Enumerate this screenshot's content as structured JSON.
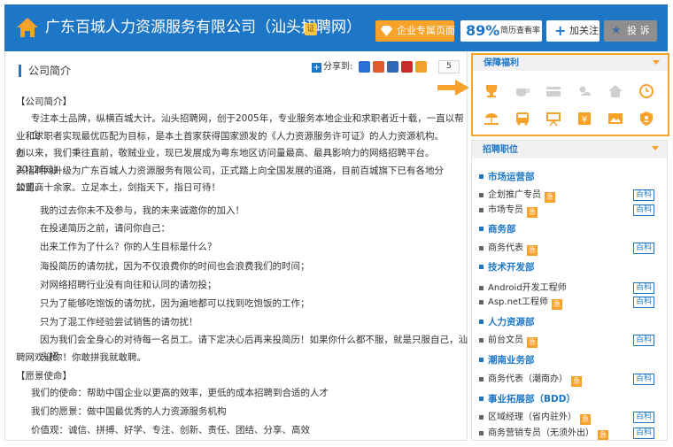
{
  "header": {
    "company_name": "广东百城人力资源服务有限公司（汕头招聘网）",
    "cert_label": "证",
    "enterprise_page_label": "企业专属页面",
    "resume_rate_value": "89%",
    "resume_rate_label": "简历查看率",
    "follow_label": "加关注",
    "report_label": "投 诉"
  },
  "intro": {
    "title": "公司简介",
    "share_label": "分享到:",
    "share_count": "5",
    "share_sites": [
      {
        "name": "qzone",
        "color": "#2a6fd6"
      },
      {
        "name": "sina-weibo",
        "color": "#e25b2a"
      },
      {
        "name": "renren",
        "color": "#2d69b7"
      },
      {
        "name": "kaixin",
        "color": "#c72b2a"
      },
      {
        "name": "tencent-weibo",
        "color": "#f1a22e"
      },
      {
        "name": "douban",
        "color": "#3f9e3f"
      },
      {
        "name": "baidu",
        "color": "#2c62c7"
      }
    ],
    "paragraphs": [
      "【公司简介】",
      "专注本土品牌，纵横百城大计。汕头招聘网，创于2005年，专业服务本地企业和求职者近十载，一直以帮企",
      "业和求职者实现最优匹配为目标，是本土首家获得国家颁发的《人力资源服务许可证》的人力资源机构。创",
      "办以来，我们秉往直前，敬贼业业，现已发展成为粤东地区访问量最高、最具影响力的网络招聘平台。2012年汕",
      "头招聘网升级为广东百城人力资源服务有限公司，正式踏上向全国发展的道路，目前百城旗下已有各地分公司、",
      "加盟商十余家。立足本土，剑指天下，指日可待！",
      "我的过去你未不及参与，我的未来诚邀你的加入！",
      "在投递简历之前，请问你自己：",
      "出来工作为了什么？你的人生目标是什么？",
      "海投简历的请勿扰，因为不仅浪费你的时间也会浪费我们的时间；",
      "对网络招聘行业没有向往和认同的请勿投；",
      "只为了能够吃饱饭的请勿扰，因为遍地都可以找到吃饱饭的工作；",
      "只为了混工作经验尝试销售的请勿扰！",
      "因为我们会全身心的对待每一名员工。请下定决心后再来投简历！如果你什么都不服，就是只服自己，汕头招",
      "聘网欢迎你！你敢拼我就敢聘。",
      "【愿景使命】",
      "我们的使命：帮助中国企业以更高的效率，更低的成本招聘到合适的人才",
      "我们的愿景：做中国最优秀的人力资源服务机构",
      "价值观：诚信、拼搏、好学、专注、创新、责任、团结、分享、高效"
    ]
  },
  "benefits": {
    "title": "保障福利",
    "icons": [
      {
        "name": "bonus-cup",
        "color": "#f7a22b"
      },
      {
        "name": "coffee",
        "color": "#cfcfcf"
      },
      {
        "name": "card",
        "color": "#cfcfcf"
      },
      {
        "name": "sun-weather",
        "color": "#cfcfcf"
      },
      {
        "name": "housing",
        "color": "#cfcfcf"
      },
      {
        "name": "clock",
        "color": "#f7a22b"
      },
      {
        "name": "beach-travel",
        "color": "#f7a22b"
      },
      {
        "name": "shuttle-bus",
        "color": "#f7a22b"
      },
      {
        "name": "training-board",
        "color": "#f7a22b"
      },
      {
        "name": "yuan-allowance",
        "color": "#f7a22b"
      },
      {
        "name": "photo-activities",
        "color": "#f7a22b"
      },
      {
        "name": "insurance-shield",
        "color": "#f7a22b"
      }
    ]
  },
  "jobs": {
    "title": "招聘职位",
    "wiki_label": "百科",
    "job_icon_label": "急",
    "entries": [
      {
        "kind": "dept",
        "label": "市场运营部"
      },
      {
        "kind": "job",
        "label": "企划推广专员",
        "wiki": true
      },
      {
        "kind": "job",
        "label": "市场专员",
        "wiki": true
      },
      {
        "kind": "dept",
        "label": "商务部"
      },
      {
        "kind": "job",
        "label": "商务代表",
        "wiki": true
      },
      {
        "kind": "dept",
        "label": "技术开发部"
      },
      {
        "kind": "job",
        "label": "Android开发工程师",
        "wiki": true
      },
      {
        "kind": "job",
        "label": "Asp.net工程师",
        "wiki": true
      },
      {
        "kind": "dept",
        "label": "人力资源部"
      },
      {
        "kind": "job",
        "label": "前台文员",
        "wiki": true
      },
      {
        "kind": "dept",
        "label": "潮南业务部"
      },
      {
        "kind": "job",
        "label": "商务代表（潮南办）",
        "wiki": true
      },
      {
        "kind": "dept",
        "label": "事业拓展部（BDD）"
      },
      {
        "kind": "job",
        "label": "区域经理（省内驻外）",
        "wiki": true
      },
      {
        "kind": "job",
        "label": "商务营销专员（无须外出）",
        "wiki": true
      }
    ]
  }
}
